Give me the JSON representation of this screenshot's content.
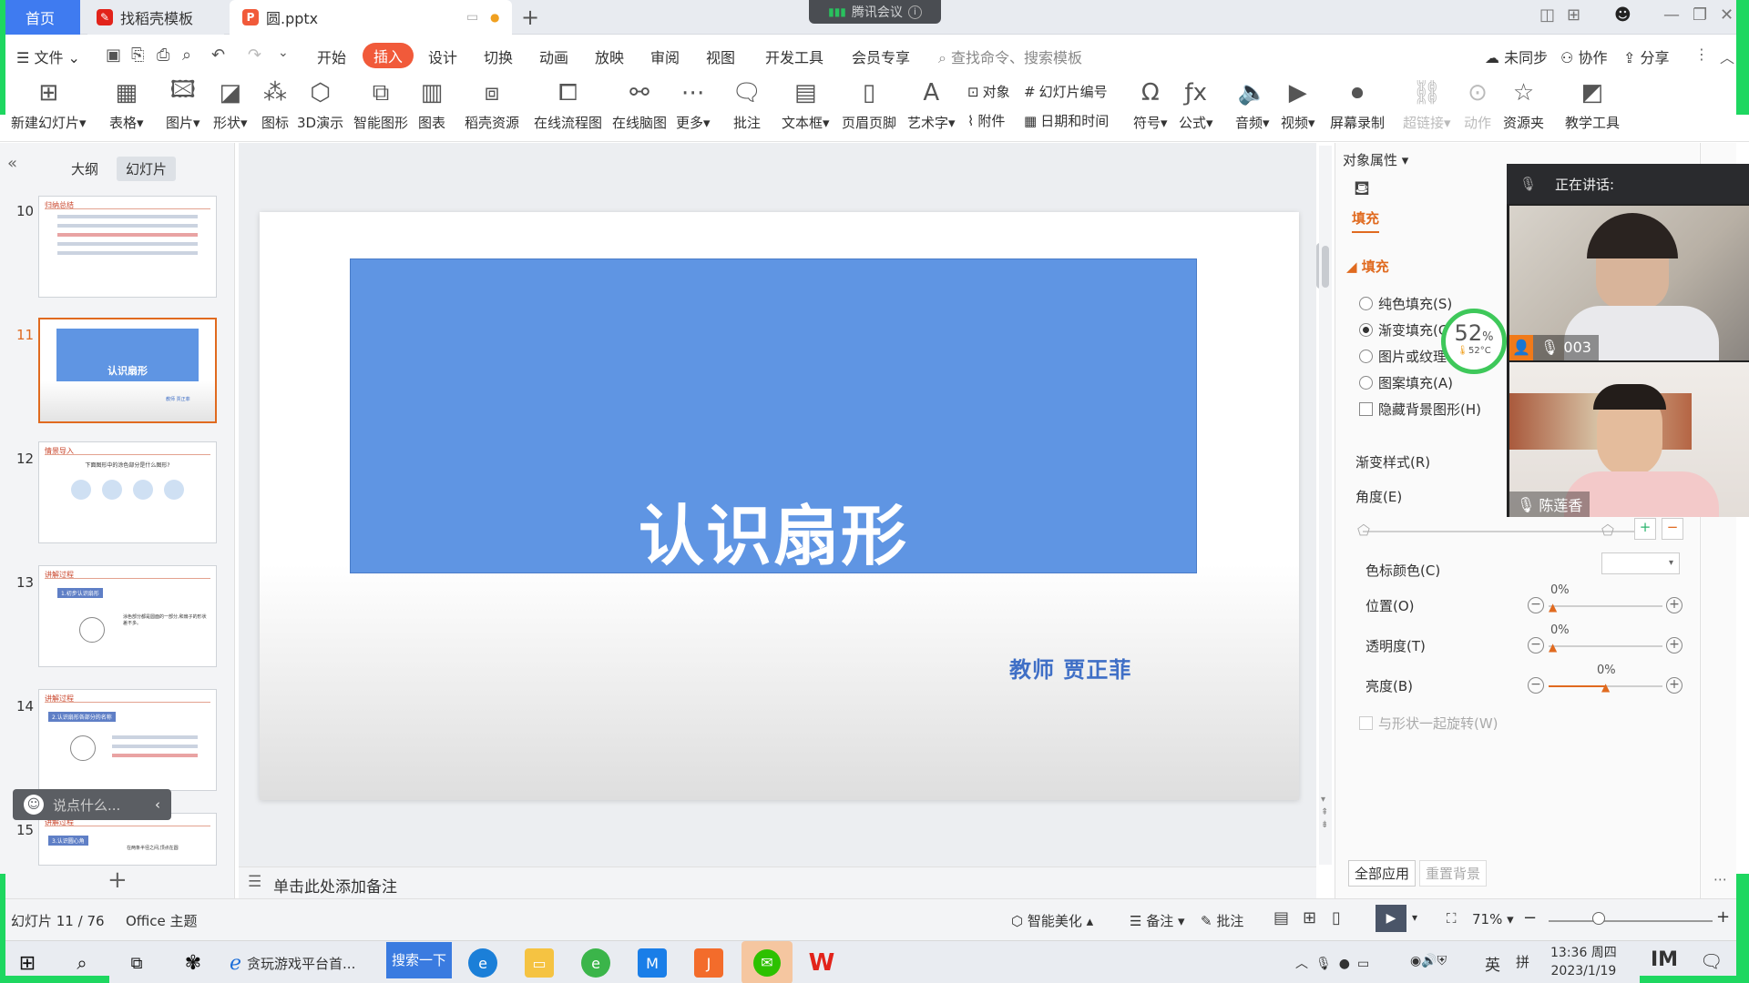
{
  "tabs": {
    "home": "首页",
    "daoke": "找稻壳模板",
    "file": "圆.pptx"
  },
  "meeting": {
    "label": "腾讯会议"
  },
  "menu": {
    "file": "文件",
    "items": [
      "开始",
      "插入",
      "设计",
      "切换",
      "动画",
      "放映",
      "审阅",
      "视图",
      "开发工具",
      "会员专享"
    ],
    "search_placeholder": "查找命令、搜索模板",
    "sync": "未同步",
    "collab": "协作",
    "share": "分享"
  },
  "ribbon": {
    "new_slide": "新建幻灯片",
    "table": "表格",
    "image": "图片",
    "shape": "形状",
    "icon": "图标",
    "d3": "3D演示",
    "smart": "智能图形",
    "chart": "图表",
    "daoke_res": "稻壳资源",
    "flowchart": "在线流程图",
    "mindmap": "在线脑图",
    "more": "更多",
    "comment": "批注",
    "textbox": "文本框",
    "header_footer": "页眉页脚",
    "wordart": "艺术字",
    "object": "对象",
    "attach": "附件",
    "slide_num": "幻灯片编号",
    "datetime": "日期和时间",
    "symbol": "符号",
    "formula": "公式",
    "audio": "音频",
    "video": "视频",
    "screenrec": "屏幕录制",
    "hyperlink": "超链接",
    "action": "动作",
    "resource": "资源夹",
    "teach": "教学工具"
  },
  "leftpanel": {
    "outline": "大纲",
    "slides": "幻灯片",
    "chat_placeholder": "说点什么...",
    "thumbs": [
      {
        "num": "10",
        "header": "归纳总结"
      },
      {
        "num": "11",
        "title": "认识扇形",
        "sub": "教师 贾正菲"
      },
      {
        "num": "12",
        "header": "情景导入",
        "text": "下面图形中的涂色部分是什么图形?"
      },
      {
        "num": "13",
        "header": "讲解过程",
        "tag": "1.初步认识扇形",
        "text": "涂色部分都是圆面的一部分,和扇子的形状差不多。"
      },
      {
        "num": "14",
        "header": "讲解过程",
        "tag": "2.认识扇形各部分的名称"
      },
      {
        "num": "15",
        "header": "讲解过程",
        "tag": "3.认识圆心角",
        "text": "在两条半径之间,顶点在圆"
      }
    ]
  },
  "slide": {
    "title": "认识扇形",
    "teacher": "教师  贾正菲"
  },
  "notes": {
    "placeholder": "单击此处添加备注"
  },
  "props": {
    "header": "对象属性",
    "tab_fill": "填充",
    "section_fill": "填充",
    "solid": "纯色填充(S)",
    "gradient": "渐变填充(G)",
    "picture": "图片或纹理",
    "pattern": "图案填充(A)",
    "hide_bg": "隐藏背景图形(H)",
    "gradient_style": "渐变样式(R)",
    "angle": "角度(E)",
    "stop_color": "色标颜色(C)",
    "position": "位置(O)",
    "position_val": "0%",
    "transparency": "透明度(T)",
    "transparency_val": "0%",
    "brightness": "亮度(B)",
    "brightness_val": "0%",
    "rotate": "与形状一起旋转(W)",
    "apply_all": "全部应用",
    "reset_bg": "重置背景",
    "cpu_pct": "52",
    "cpu_temp": "52°C"
  },
  "video": {
    "speaking": "正在讲话:",
    "p1": "003",
    "p2": "陈莲香"
  },
  "status": {
    "slide": "幻灯片 11 / 76",
    "theme": "Office 主题",
    "beautify": "智能美化",
    "notes": "备注",
    "comment": "批注",
    "zoom": "71%"
  },
  "taskbar": {
    "browser_tab": "贪玩游戏平台首...",
    "search_btn": "搜索一下",
    "time": "13:36 周四",
    "date": "2023/1/19",
    "lang": "英"
  },
  "colors": {
    "accent": "#f15a3a",
    "slide_blue": "#5f95e3",
    "home_tab": "#3f7bf0",
    "green_border": "#1ed760"
  }
}
